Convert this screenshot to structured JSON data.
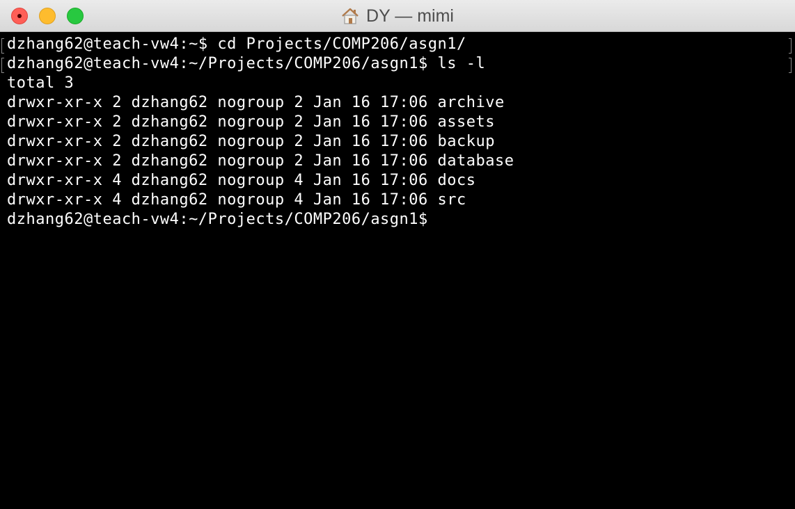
{
  "window": {
    "title": "DY — mimi",
    "title_icon": "home-icon",
    "colors": {
      "close": "#fe5f57",
      "minimize": "#febc2e",
      "zoom": "#28c840",
      "terminal_bg": "#000000",
      "terminal_fg": "#ffffff"
    }
  },
  "terminal": {
    "lines": [
      "dzhang62@teach-vw4:~$ cd Projects/COMP206/asgn1/",
      "dzhang62@teach-vw4:~/Projects/COMP206/asgn1$ ls -l",
      "total 3",
      "drwxr-xr-x 2 dzhang62 nogroup 2 Jan 16 17:06 archive",
      "drwxr-xr-x 2 dzhang62 nogroup 2 Jan 16 17:06 assets",
      "drwxr-xr-x 2 dzhang62 nogroup 2 Jan 16 17:06 backup",
      "drwxr-xr-x 2 dzhang62 nogroup 2 Jan 16 17:06 database",
      "drwxr-xr-x 4 dzhang62 nogroup 4 Jan 16 17:06 docs",
      "drwxr-xr-x 4 dzhang62 nogroup 4 Jan 16 17:06 src",
      "dzhang62@teach-vw4:~/Projects/COMP206/asgn1$"
    ]
  }
}
